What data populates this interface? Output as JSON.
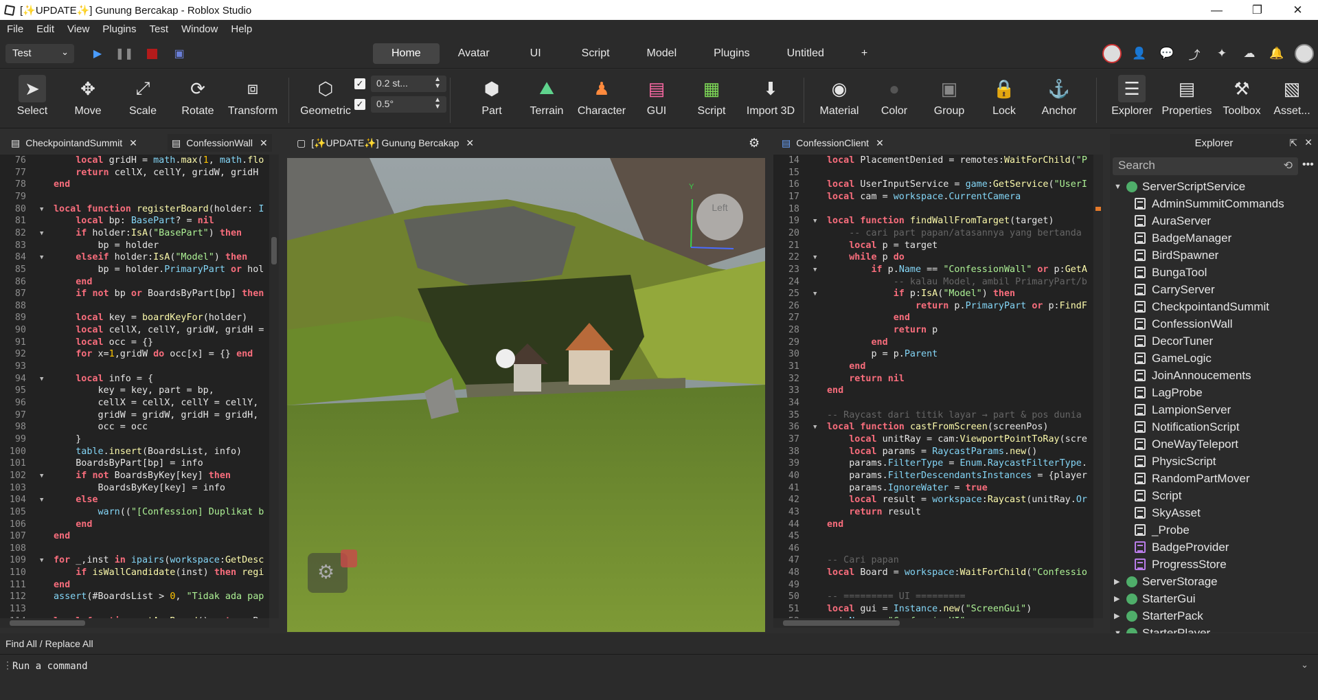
{
  "window": {
    "title": "[✨UPDATE✨] Gunung Bercakap - Roblox Studio",
    "minimize": "—",
    "maximize": "❐",
    "close": "✕"
  },
  "menu": [
    "File",
    "Edit",
    "View",
    "Plugins",
    "Test",
    "Window",
    "Help"
  ],
  "toolbar": {
    "mode": "Test",
    "tabs": [
      "Home",
      "Avatar",
      "UI",
      "Script",
      "Model",
      "Plugins",
      "Untitled",
      "+"
    ],
    "active_tab": "Home"
  },
  "ribbon": {
    "tools": [
      {
        "label": "Select",
        "icon": "cursor-icon"
      },
      {
        "label": "Move",
        "icon": "move-icon"
      },
      {
        "label": "Scale",
        "icon": "scale-icon"
      },
      {
        "label": "Rotate",
        "icon": "rotate-icon"
      },
      {
        "label": "Transform",
        "icon": "transform-icon"
      },
      {
        "label": "Geometric",
        "icon": "geometric-icon"
      },
      {
        "label": "Part",
        "icon": "part-icon"
      },
      {
        "label": "Terrain",
        "icon": "terrain-icon"
      },
      {
        "label": "Character",
        "icon": "character-icon"
      },
      {
        "label": "GUI",
        "icon": "gui-icon"
      },
      {
        "label": "Script",
        "icon": "script-icon"
      },
      {
        "label": "Import 3D",
        "icon": "import-icon"
      },
      {
        "label": "Material",
        "icon": "material-icon"
      },
      {
        "label": "Color",
        "icon": "color-icon"
      },
      {
        "label": "Group",
        "icon": "group-icon"
      },
      {
        "label": "Lock",
        "icon": "lock-icon"
      },
      {
        "label": "Anchor",
        "icon": "anchor-icon"
      },
      {
        "label": "Explorer",
        "icon": "explorer-icon"
      },
      {
        "label": "Properties",
        "icon": "properties-icon"
      },
      {
        "label": "Toolbox",
        "icon": "toolbox-icon"
      },
      {
        "label": "Asset...",
        "icon": "asset-icon"
      }
    ],
    "move_snap": "0.2 st...",
    "rotate_snap": "0.5°"
  },
  "panels": {
    "left_tabs": [
      "CheckpointandSummit",
      "ConfessionWall"
    ],
    "center_tab": "[✨UPDATE✨] Gunung Bercakap",
    "right_tab": "ConfessionClient",
    "explorer_title": "Explorer"
  },
  "viewport": {
    "view_cube_label": "Left",
    "axis_label": "Y"
  },
  "left_code": {
    "lines": [
      {
        "n": "76",
        "f": "",
        "html": "    <span class='kw'>local</span> gridH = <span class='bi'>math</span>.<span class='fn'>max</span>(<span class='nm'>1</span>, <span class='bi'>math</span>.<span class='fn'>flo</span>"
      },
      {
        "n": "77",
        "f": "",
        "html": "    <span class='kw'>return</span> cellX, cellY, gridW, gridH"
      },
      {
        "n": "78",
        "f": "",
        "html": "<span class='kw'>end</span>"
      },
      {
        "n": "79",
        "f": "",
        "html": ""
      },
      {
        "n": "80",
        "f": "▼",
        "html": "<span class='kw'>local</span> <span class='kw'>function</span> <span class='fn'>registerBoard</span>(holder: <span class='bi'>I</span>"
      },
      {
        "n": "81",
        "f": "",
        "html": "    <span class='kw'>local</span> bp: <span class='bi'>BasePart</span>? = <span class='kw'>nil</span>"
      },
      {
        "n": "82",
        "f": "▼",
        "html": "    <span class='kw'>if</span> holder:<span class='fn'>IsA</span>(<span class='st'>\"BasePart\"</span>) <span class='kw'>then</span>"
      },
      {
        "n": "83",
        "f": "",
        "html": "        bp = holder"
      },
      {
        "n": "84",
        "f": "▼",
        "html": "    <span class='kw'>elseif</span> holder:<span class='fn'>IsA</span>(<span class='st'>\"Model\"</span>) <span class='kw'>then</span>"
      },
      {
        "n": "85",
        "f": "",
        "html": "        bp = holder.<span class='bi'>PrimaryPart</span> <span class='kw'>or</span> hol"
      },
      {
        "n": "86",
        "f": "",
        "html": "    <span class='kw'>end</span>"
      },
      {
        "n": "87",
        "f": "",
        "html": "    <span class='kw'>if</span> <span class='kw'>not</span> bp <span class='kw'>or</span> BoardsByPart[bp] <span class='kw'>then</span>"
      },
      {
        "n": "88",
        "f": "",
        "html": ""
      },
      {
        "n": "89",
        "f": "",
        "html": "    <span class='kw'>local</span> key = <span class='fn'>boardKeyFor</span>(holder)"
      },
      {
        "n": "90",
        "f": "",
        "html": "    <span class='kw'>local</span> cellX, cellY, gridW, gridH ="
      },
      {
        "n": "91",
        "f": "",
        "html": "    <span class='kw'>local</span> occ = {}"
      },
      {
        "n": "92",
        "f": "",
        "html": "    <span class='kw'>for</span> x=<span class='nm'>1</span>,gridW <span class='kw'>do</span> occ[x] = {} <span class='kw'>end</span>"
      },
      {
        "n": "93",
        "f": "",
        "html": ""
      },
      {
        "n": "94",
        "f": "▼",
        "html": "    <span class='kw'>local</span> info = {"
      },
      {
        "n": "95",
        "f": "",
        "html": "        key = key, part = bp,"
      },
      {
        "n": "96",
        "f": "",
        "html": "        cellX = cellX, cellY = cellY,"
      },
      {
        "n": "97",
        "f": "",
        "html": "        gridW = gridW, gridH = gridH,"
      },
      {
        "n": "98",
        "f": "",
        "html": "        occ = occ"
      },
      {
        "n": "99",
        "f": "",
        "html": "    }"
      },
      {
        "n": "100",
        "f": "",
        "html": "    <span class='bi'>table</span>.<span class='fn'>insert</span>(BoardsList, info)"
      },
      {
        "n": "101",
        "f": "",
        "html": "    BoardsByPart[bp] = info"
      },
      {
        "n": "102",
        "f": "▼",
        "html": "    <span class='kw'>if</span> <span class='kw'>not</span> BoardsByKey[key] <span class='kw'>then</span>"
      },
      {
        "n": "103",
        "f": "",
        "html": "        BoardsByKey[key] = info"
      },
      {
        "n": "104",
        "f": "▼",
        "html": "    <span class='kw'>else</span>"
      },
      {
        "n": "105",
        "f": "",
        "html": "        <span class='bi'>warn</span>((<span class='st'>\"[Confession] Duplikat b</span>"
      },
      {
        "n": "106",
        "f": "",
        "html": "    <span class='kw'>end</span>"
      },
      {
        "n": "107",
        "f": "",
        "html": "<span class='kw'>end</span>"
      },
      {
        "n": "108",
        "f": "",
        "html": ""
      },
      {
        "n": "109",
        "f": "▼",
        "html": "<span class='kw'>for</span> _,inst <span class='kw'>in</span> <span class='bi'>ipairs</span>(<span class='bi'>workspace</span>:<span class='fn'>GetDesc</span>"
      },
      {
        "n": "110",
        "f": "",
        "html": "    <span class='kw'>if</span> <span class='fn'>isWallCandidate</span>(inst) <span class='kw'>then</span> <span class='fn'>regi</span>"
      },
      {
        "n": "111",
        "f": "",
        "html": "<span class='kw'>end</span>"
      },
      {
        "n": "112",
        "f": "",
        "html": "<span class='bi'>assert</span>(#BoardsList > <span class='nm'>0</span>, <span class='st'>\"Tidak ada pap</span>"
      },
      {
        "n": "113",
        "f": "",
        "html": ""
      },
      {
        "n": "114",
        "f": "",
        "html": "<span class='kw'>local</span> <span class='kw'>function</span> <span class='fn'>getAnyBoard</span>() <span class='kw'>return</span> Bo"
      }
    ]
  },
  "right_code": {
    "lines": [
      {
        "n": "14",
        "f": "",
        "html": "<span class='kw'>local</span> PlacementDenied = remotes:<span class='fn'>WaitForChild</span>(<span class='st'>\"P</span>"
      },
      {
        "n": "15",
        "f": "",
        "html": ""
      },
      {
        "n": "16",
        "f": "",
        "html": "<span class='kw'>local</span> UserInputService = <span class='bi'>game</span>:<span class='fn'>GetService</span>(<span class='st'>\"UserI</span>"
      },
      {
        "n": "17",
        "f": "",
        "html": "<span class='kw'>local</span> cam = <span class='bi'>workspace</span>.<span class='bi'>CurrentCamera</span>"
      },
      {
        "n": "18",
        "f": "",
        "html": ""
      },
      {
        "n": "19",
        "f": "▼",
        "html": "<span class='kw'>local</span> <span class='kw'>function</span> <span class='fn'>findWallFromTarget</span>(target)"
      },
      {
        "n": "20",
        "f": "",
        "html": "    <span class='cm'>-- cari part papan/atasannya yang bertanda</span>"
      },
      {
        "n": "21",
        "f": "",
        "html": "    <span class='kw'>local</span> p = target"
      },
      {
        "n": "22",
        "f": "▼",
        "html": "    <span class='kw'>while</span> p <span class='kw'>do</span>"
      },
      {
        "n": "23",
        "f": "▼",
        "html": "        <span class='kw'>if</span> p.<span class='bi'>Name</span> == <span class='st'>\"ConfessionWall\"</span> <span class='kw'>or</span> p:<span class='fn'>GetA</span>"
      },
      {
        "n": "24",
        "f": "",
        "html": "            <span class='cm'>-- kalau Model, ambil PrimaryPart/b</span>"
      },
      {
        "n": "25",
        "f": "▼",
        "html": "            <span class='kw'>if</span> p:<span class='fn'>IsA</span>(<span class='st'>\"Model\"</span>) <span class='kw'>then</span>"
      },
      {
        "n": "26",
        "f": "",
        "html": "                <span class='kw'>return</span> p.<span class='bi'>PrimaryPart</span> <span class='kw'>or</span> p:<span class='fn'>FindF</span>"
      },
      {
        "n": "27",
        "f": "",
        "html": "            <span class='kw'>end</span>"
      },
      {
        "n": "28",
        "f": "",
        "html": "            <span class='kw'>return</span> p"
      },
      {
        "n": "29",
        "f": "",
        "html": "        <span class='kw'>end</span>"
      },
      {
        "n": "30",
        "f": "",
        "html": "        p = p.<span class='bi'>Parent</span>"
      },
      {
        "n": "31",
        "f": "",
        "html": "    <span class='kw'>end</span>"
      },
      {
        "n": "32",
        "f": "",
        "html": "    <span class='kw'>return</span> <span class='kw'>nil</span>"
      },
      {
        "n": "33",
        "f": "",
        "html": "<span class='kw'>end</span>"
      },
      {
        "n": "34",
        "f": "",
        "html": ""
      },
      {
        "n": "35",
        "f": "",
        "html": "<span class='cm'>-- Raycast dari titik layar → part & pos dunia</span>"
      },
      {
        "n": "36",
        "f": "▼",
        "html": "<span class='kw'>local</span> <span class='kw'>function</span> <span class='fn'>castFromScreen</span>(screenPos)"
      },
      {
        "n": "37",
        "f": "",
        "html": "    <span class='kw'>local</span> unitRay = cam:<span class='fn'>ViewportPointToRay</span>(scre"
      },
      {
        "n": "38",
        "f": "",
        "html": "    <span class='kw'>local</span> params = <span class='bi'>RaycastParams</span>.<span class='fn'>new</span>()"
      },
      {
        "n": "39",
        "f": "",
        "html": "    params.<span class='bi'>FilterType</span> = <span class='bi'>Enum</span>.<span class='bi'>RaycastFilterType</span>."
      },
      {
        "n": "40",
        "f": "",
        "html": "    params.<span class='bi'>FilterDescendantsInstances</span> = {player"
      },
      {
        "n": "41",
        "f": "",
        "html": "    params.<span class='bi'>IgnoreWater</span> = <span class='kw'>true</span>"
      },
      {
        "n": "42",
        "f": "",
        "html": "    <span class='kw'>local</span> result = <span class='bi'>workspace</span>:<span class='fn'>Raycast</span>(unitRay.<span class='bi'>Or</span>"
      },
      {
        "n": "43",
        "f": "",
        "html": "    <span class='kw'>return</span> result"
      },
      {
        "n": "44",
        "f": "",
        "html": "<span class='kw'>end</span>"
      },
      {
        "n": "45",
        "f": "",
        "html": ""
      },
      {
        "n": "46",
        "f": "",
        "html": ""
      },
      {
        "n": "47",
        "f": "",
        "html": "<span class='cm'>-- Cari papan</span>"
      },
      {
        "n": "48",
        "f": "",
        "html": "<span class='kw'>local</span> Board = <span class='bi'>workspace</span>:<span class='fn'>WaitForChild</span>(<span class='st'>\"Confessio</span>"
      },
      {
        "n": "49",
        "f": "",
        "html": ""
      },
      {
        "n": "50",
        "f": "",
        "html": "<span class='cm'>-- ========= UI =========</span>"
      },
      {
        "n": "51",
        "f": "",
        "html": "<span class='kw'>local</span> gui = <span class='bi'>Instance</span>.<span class='fn'>new</span>(<span class='st'>\"ScreenGui\"</span>)"
      },
      {
        "n": "52",
        "f": "",
        "html": "gui.<span class='bi'>Name</span> = <span class='st'>\"ConfessionUI\"</span>"
      }
    ]
  },
  "explorer": {
    "search_placeholder": "Search",
    "items": [
      {
        "label": "ServerScriptService",
        "level": 0,
        "arrow": "▼",
        "type": "service"
      },
      {
        "label": "AdminSummitCommands",
        "level": 1,
        "arrow": "",
        "type": "script"
      },
      {
        "label": "AuraServer",
        "level": 1,
        "arrow": "",
        "type": "script"
      },
      {
        "label": "BadgeManager",
        "level": 1,
        "arrow": "",
        "type": "script"
      },
      {
        "label": "BirdSpawner",
        "level": 1,
        "arrow": "",
        "type": "script"
      },
      {
        "label": "BungaTool",
        "level": 1,
        "arrow": "",
        "type": "script"
      },
      {
        "label": "CarryServer",
        "level": 1,
        "arrow": "",
        "type": "script"
      },
      {
        "label": "CheckpointandSummit",
        "level": 1,
        "arrow": "",
        "type": "script"
      },
      {
        "label": "ConfessionWall",
        "level": 1,
        "arrow": "",
        "type": "script"
      },
      {
        "label": "DecorTuner",
        "level": 1,
        "arrow": "",
        "type": "script"
      },
      {
        "label": "GameLogic",
        "level": 1,
        "arrow": "",
        "type": "script"
      },
      {
        "label": "JoinAnnoucements",
        "level": 1,
        "arrow": "",
        "type": "script"
      },
      {
        "label": "LagProbe",
        "level": 1,
        "arrow": "",
        "type": "script"
      },
      {
        "label": "LampionServer",
        "level": 1,
        "arrow": "",
        "type": "script"
      },
      {
        "label": "NotificationScript",
        "level": 1,
        "arrow": "",
        "type": "script"
      },
      {
        "label": "OneWayTeleport",
        "level": 1,
        "arrow": "",
        "type": "script"
      },
      {
        "label": "PhysicScript",
        "level": 1,
        "arrow": "",
        "type": "script"
      },
      {
        "label": "RandomPartMover",
        "level": 1,
        "arrow": "",
        "type": "script"
      },
      {
        "label": "Script",
        "level": 1,
        "arrow": "",
        "type": "script"
      },
      {
        "label": "SkyAsset",
        "level": 1,
        "arrow": "",
        "type": "script"
      },
      {
        "label": "_Probe",
        "level": 1,
        "arrow": "",
        "type": "script"
      },
      {
        "label": "BadgeProvider",
        "level": 1,
        "arrow": "",
        "type": "module"
      },
      {
        "label": "ProgressStore",
        "level": 1,
        "arrow": "",
        "type": "module"
      },
      {
        "label": "ServerStorage",
        "level": 0,
        "arrow": "▶",
        "type": "service"
      },
      {
        "label": "StarterGui",
        "level": 0,
        "arrow": "▶",
        "type": "service"
      },
      {
        "label": "StarterPack",
        "level": 0,
        "arrow": "▶",
        "type": "service"
      },
      {
        "label": "StarterPlayer",
        "level": 0,
        "arrow": "▼",
        "type": "service"
      }
    ]
  },
  "bottom": {
    "find_label": "Find All / Replace All",
    "command_placeholder": "Run a command"
  }
}
